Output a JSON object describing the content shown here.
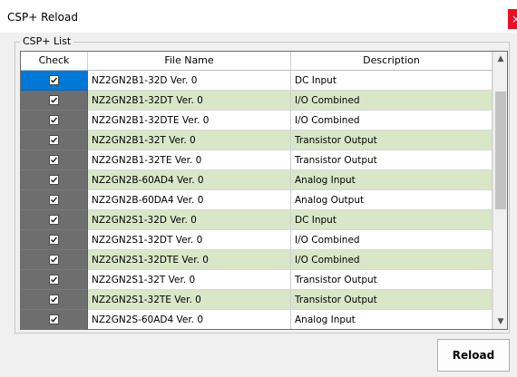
{
  "window": {
    "title": "CSP+ Reload",
    "close_label": "×"
  },
  "group": {
    "label": "CSP+ List"
  },
  "columns": {
    "check": "Check",
    "file": "File Name",
    "description": "Description"
  },
  "rows": [
    {
      "checked": true,
      "file": "NZ2GN2B1-32D Ver. 0",
      "description": "DC Input"
    },
    {
      "checked": true,
      "file": "NZ2GN2B1-32DT Ver. 0",
      "description": "I/O Combined"
    },
    {
      "checked": true,
      "file": "NZ2GN2B1-32DTE Ver. 0",
      "description": "I/O Combined"
    },
    {
      "checked": true,
      "file": "NZ2GN2B1-32T Ver. 0",
      "description": "Transistor Output"
    },
    {
      "checked": true,
      "file": "NZ2GN2B1-32TE Ver. 0",
      "description": "Transistor Output"
    },
    {
      "checked": true,
      "file": "NZ2GN2B-60AD4 Ver. 0",
      "description": "Analog Input"
    },
    {
      "checked": true,
      "file": "NZ2GN2B-60DA4 Ver. 0",
      "description": "Analog Output"
    },
    {
      "checked": true,
      "file": "NZ2GN2S1-32D Ver. 0",
      "description": "DC Input"
    },
    {
      "checked": true,
      "file": "NZ2GN2S1-32DT Ver. 0",
      "description": "I/O Combined"
    },
    {
      "checked": true,
      "file": "NZ2GN2S1-32DTE Ver. 0",
      "description": "I/O Combined"
    },
    {
      "checked": true,
      "file": "NZ2GN2S1-32T Ver. 0",
      "description": "Transistor Output"
    },
    {
      "checked": true,
      "file": "NZ2GN2S1-32TE Ver. 0",
      "description": "Transistor Output"
    },
    {
      "checked": true,
      "file": "NZ2GN2S-60AD4 Ver. 0",
      "description": "Analog Input"
    }
  ],
  "buttons": {
    "reload": "Reload"
  },
  "colors": {
    "row_alt": "#d8e7c7",
    "check_column": "#6e6e6e",
    "selected": "#0078d7",
    "close": "#e81123"
  }
}
